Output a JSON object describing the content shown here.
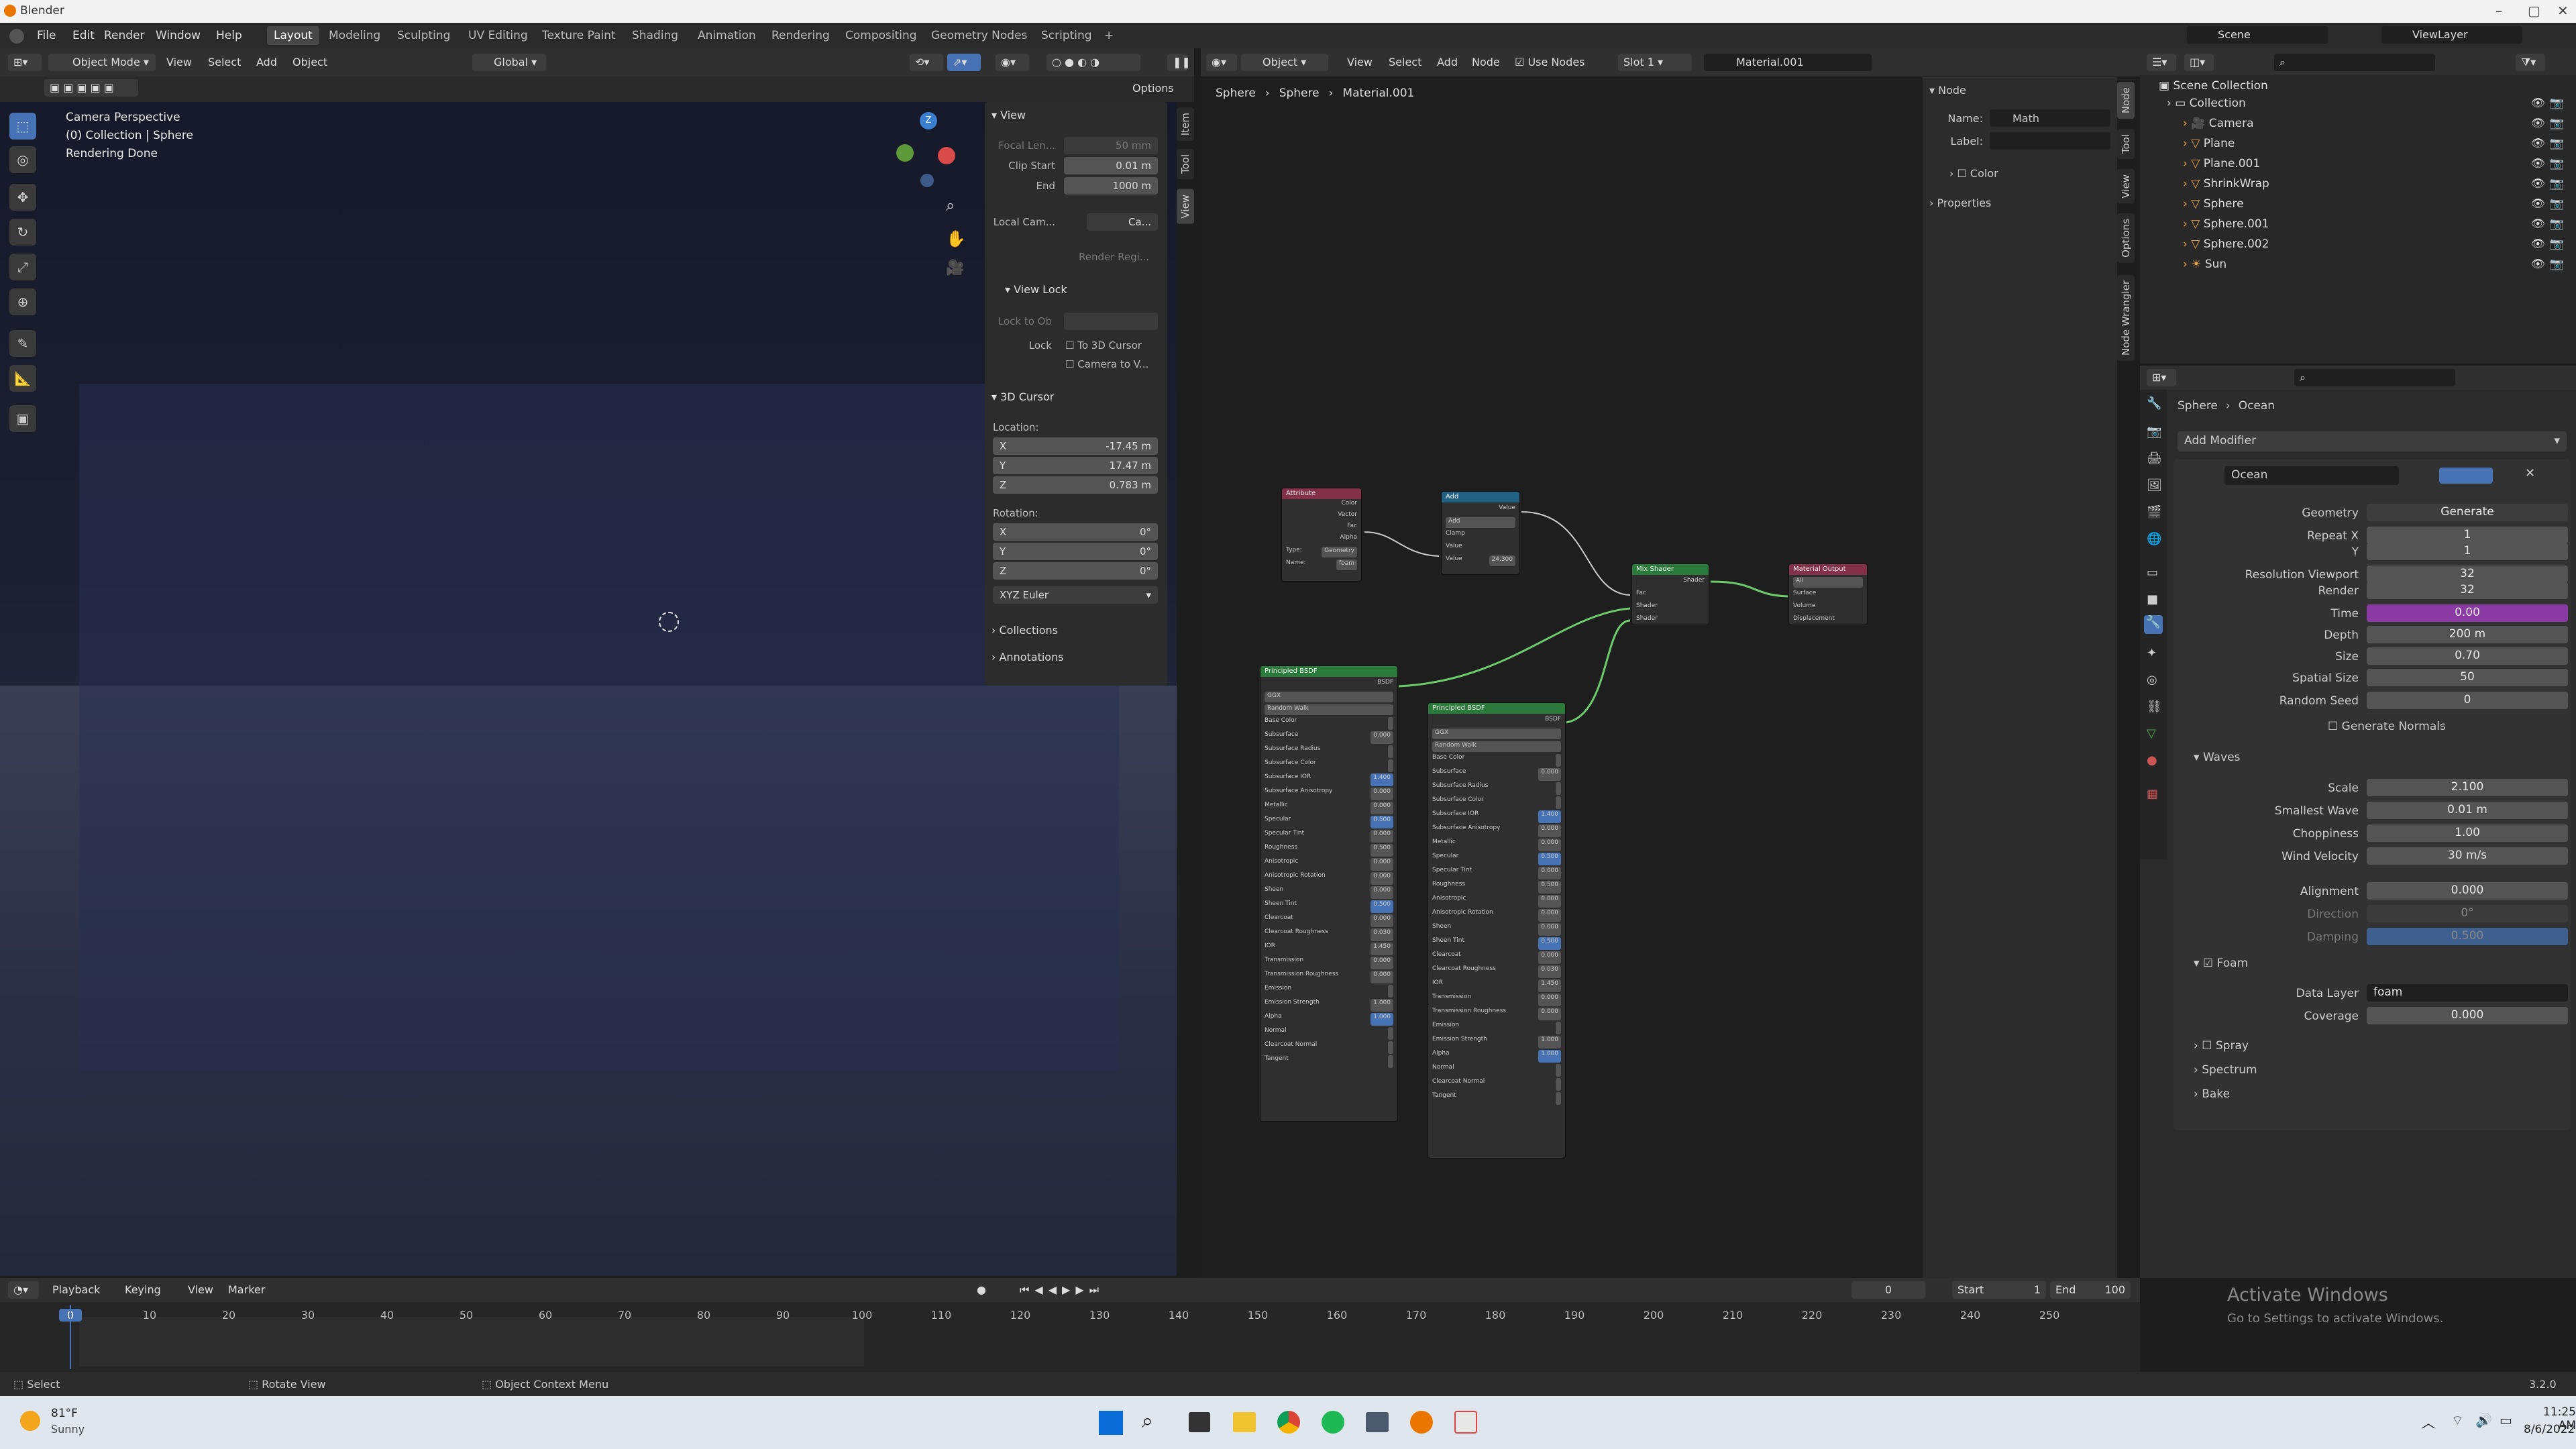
{
  "window": {
    "title": "Blender"
  },
  "menu": {
    "items": [
      "File",
      "Edit",
      "Render",
      "Window",
      "Help"
    ]
  },
  "workspaces": [
    "Layout",
    "Modeling",
    "Sculpting",
    "UV Editing",
    "Texture Paint",
    "Shading",
    "Animation",
    "Rendering",
    "Compositing",
    "Geometry Nodes",
    "Scripting"
  ],
  "workspace_plus": "+",
  "scene": {
    "label": "Scene",
    "view_layer": "ViewLayer"
  },
  "viewport": {
    "mode": "Object Mode",
    "menus": [
      "View",
      "Select",
      "Add",
      "Object"
    ],
    "orientation": "Global",
    "options": "Options",
    "overlay_lines": [
      "Camera Perspective",
      "(0) Collection | Sphere",
      "Rendering Done"
    ]
  },
  "npanel": {
    "tabs": [
      "Item",
      "Tool",
      "View"
    ],
    "view_header": "View",
    "focal_label": "Focal Len...",
    "focal_value": "50 mm",
    "clip_start_label": "Clip Start",
    "clip_start": "0.01 m",
    "end_label": "End",
    "clip_end": "1000 m",
    "local_cam_label": "Local Cam...",
    "local_cam_field": "Ca...",
    "render_region": "Render Regi...",
    "view_lock_header": "View Lock",
    "lock_to_obj": "Lock to Ob",
    "lock_label": "Lock",
    "to_3d_cursor": "To 3D Cursor",
    "camera_to_view": "Camera to V...",
    "cursor_header": "3D Cursor",
    "location_label": "Location:",
    "x_label": "X",
    "y_label": "Y",
    "z_label": "Z",
    "loc_x": "-17.45 m",
    "loc_y": "17.47 m",
    "loc_z": "0.783 m",
    "rotation_label": "Rotation:",
    "rot_x": "0°",
    "rot_y": "0°",
    "rot_z": "0°",
    "euler": "XYZ Euler",
    "collections": "Collections",
    "annotations": "Annotations"
  },
  "node_editor": {
    "object_menu": "Object",
    "menus": [
      "View",
      "Select",
      "Add",
      "Node"
    ],
    "use_nodes": "Use Nodes",
    "slot": "Slot 1",
    "material": "Material.001",
    "breadcrumb": [
      "Sphere",
      "Sphere",
      "Material.001"
    ],
    "nodes": {
      "attribute": {
        "title": "Attribute",
        "outputs": [
          "Color",
          "Vector",
          "Fac",
          "Alpha"
        ],
        "type_label": "Type:",
        "type_value": "Geometry",
        "name_label": "Name:",
        "name_value": "foam"
      },
      "add": {
        "title": "Add",
        "output": "Value",
        "op": "Add",
        "clamp": "Clamp",
        "value_label": "Value",
        "value2_label": "Value",
        "value2": "24.300"
      },
      "mix": {
        "title": "Mix Shader",
        "output": "Shader",
        "inputs": [
          "Fac",
          "Shader",
          "Shader"
        ]
      },
      "output": {
        "title": "Material Output",
        "target": "All",
        "inputs": [
          "Surface",
          "Volume",
          "Displacement"
        ]
      },
      "bsdf1": {
        "title": "Principled BSDF",
        "output": "BSDF",
        "dist": "GGX",
        "sss": "Random Walk",
        "rows": [
          [
            "Base Color",
            ""
          ],
          [
            "Subsurface",
            "0.000"
          ],
          [
            "Subsurface Radius",
            ""
          ],
          [
            "Subsurface Color",
            ""
          ],
          [
            "Subsurface IOR",
            "1.400"
          ],
          [
            "Subsurface Anisotropy",
            "0.000"
          ],
          [
            "Metallic",
            "0.000"
          ],
          [
            "Specular",
            "0.500"
          ],
          [
            "Specular Tint",
            "0.000"
          ],
          [
            "Roughness",
            "0.500"
          ],
          [
            "Anisotropic",
            "0.000"
          ],
          [
            "Anisotropic Rotation",
            "0.000"
          ],
          [
            "Sheen",
            "0.000"
          ],
          [
            "Sheen Tint",
            "0.500"
          ],
          [
            "Clearcoat",
            "0.000"
          ],
          [
            "Clearcoat Roughness",
            "0.030"
          ],
          [
            "IOR",
            "1.450"
          ],
          [
            "Transmission",
            "0.000"
          ],
          [
            "Transmission Roughness",
            "0.000"
          ],
          [
            "Emission",
            ""
          ],
          [
            "Emission Strength",
            "1.000"
          ],
          [
            "Alpha",
            "1.000"
          ],
          [
            "Normal",
            ""
          ],
          [
            "Clearcoat Normal",
            ""
          ],
          [
            "Tangent",
            ""
          ]
        ]
      },
      "bsdf2": {
        "title": "Principled BSDF",
        "output": "BSDF",
        "dist": "GGX",
        "sss": "Random Walk",
        "rows": [
          [
            "Base Color",
            ""
          ],
          [
            "Subsurface",
            "0.000"
          ],
          [
            "Subsurface Radius",
            ""
          ],
          [
            "Subsurface Color",
            ""
          ],
          [
            "Subsurface IOR",
            "1.400"
          ],
          [
            "Subsurface Anisotropy",
            "0.000"
          ],
          [
            "Metallic",
            "0.000"
          ],
          [
            "Specular",
            "0.500"
          ],
          [
            "Specular Tint",
            "0.000"
          ],
          [
            "Roughness",
            "0.500"
          ],
          [
            "Anisotropic",
            "0.000"
          ],
          [
            "Anisotropic Rotation",
            "0.000"
          ],
          [
            "Sheen",
            "0.000"
          ],
          [
            "Sheen Tint",
            "0.500"
          ],
          [
            "Clearcoat",
            "0.000"
          ],
          [
            "Clearcoat Roughness",
            "0.030"
          ],
          [
            "IOR",
            "1.450"
          ],
          [
            "Transmission",
            "0.000"
          ],
          [
            "Transmission Roughness",
            "0.000"
          ],
          [
            "Emission",
            ""
          ],
          [
            "Emission Strength",
            "1.000"
          ],
          [
            "Alpha",
            "1.000"
          ],
          [
            "Normal",
            ""
          ],
          [
            "Clearcoat Normal",
            ""
          ],
          [
            "Tangent",
            ""
          ]
        ]
      }
    }
  },
  "node_sidebar": {
    "header": "Node",
    "name_label": "Name:",
    "name_value": "Math",
    "label_label": "Label:",
    "color": "Color",
    "properties": "Properties",
    "tabs": [
      "Node",
      "Tool",
      "View",
      "Options",
      "Node Wrangler"
    ]
  },
  "outliner": {
    "root": "Scene Collection",
    "items": [
      "Collection",
      "Camera",
      "Plane",
      "Plane.001",
      "ShrinkWrap",
      "Sphere",
      "Sphere.001",
      "Sphere.002",
      "Sun"
    ]
  },
  "properties": {
    "breadcrumb": [
      "Sphere",
      "Ocean"
    ],
    "add_modifier": "Add Modifier",
    "modifier_name": "Ocean",
    "fields": [
      {
        "label": "Geometry",
        "value": "Generate"
      },
      {
        "label": "Repeat X",
        "value": "1"
      },
      {
        "label": "Y",
        "value": "1"
      },
      {
        "label": "Resolution Viewport",
        "value": "32"
      },
      {
        "label": "Render",
        "value": "32"
      },
      {
        "label": "Time",
        "value": "0.00"
      },
      {
        "label": "Depth",
        "value": "200 m"
      },
      {
        "label": "Size",
        "value": "0.70"
      },
      {
        "label": "Spatial Size",
        "value": "50"
      },
      {
        "label": "Random Seed",
        "value": "0"
      }
    ],
    "generate_normals": "Generate Normals",
    "waves_header": "Waves",
    "waves": [
      {
        "label": "Scale",
        "value": "2.100"
      },
      {
        "label": "Smallest Wave",
        "value": "0.01 m"
      },
      {
        "label": "Choppiness",
        "value": "1.00"
      },
      {
        "label": "Wind Velocity",
        "value": "30 m/s"
      },
      {
        "label": "Alignment",
        "value": "0.000"
      },
      {
        "label": "Direction",
        "value": "0°"
      },
      {
        "label": "Damping",
        "value": "0.500"
      }
    ],
    "foam_header": "Foam",
    "data_layer_label": "Data Layer",
    "data_layer": "foam",
    "coverage_label": "Coverage",
    "coverage": "0.000",
    "spray": "Spray",
    "spectrum": "Spectrum",
    "bake": "Bake"
  },
  "timeline": {
    "menus": [
      "Playback",
      "Keying",
      "View",
      "Marker"
    ],
    "current": "0",
    "start_label": "Start",
    "start": "1",
    "end_label": "End",
    "end": "100",
    "ticks": [
      "0",
      "10",
      "20",
      "30",
      "40",
      "50",
      "60",
      "70",
      "80",
      "90",
      "100",
      "110",
      "120",
      "130",
      "140",
      "150",
      "160",
      "170",
      "180",
      "190",
      "200",
      "210",
      "220",
      "230",
      "240",
      "250"
    ]
  },
  "status": {
    "select": "Select",
    "rotate": "Rotate View",
    "context": "Object Context Menu",
    "version": "3.2.0"
  },
  "activate": {
    "title": "Activate Windows",
    "sub": "Go to Settings to activate Windows."
  },
  "taskbar": {
    "temp": "81°F",
    "weather": "Sunny",
    "time": "11:25 AM",
    "date": "8/6/2022"
  }
}
